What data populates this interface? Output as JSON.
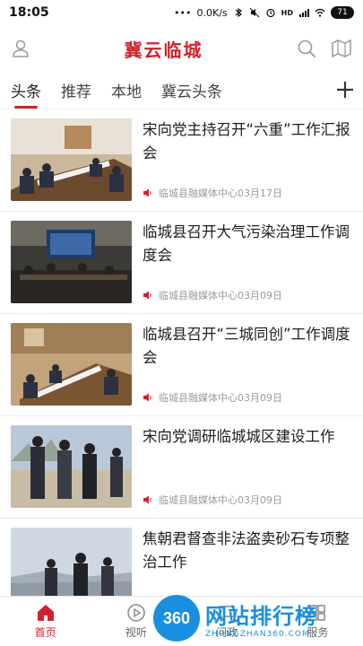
{
  "status": {
    "time": "18:05",
    "dots": "•••",
    "speed": "0.0K/s",
    "signal_hd": "HD",
    "battery": "71"
  },
  "header": {
    "logo": "冀云临城"
  },
  "tabs": [
    {
      "label": "头条"
    },
    {
      "label": "推荐"
    },
    {
      "label": "本地"
    },
    {
      "label": "冀云头条"
    }
  ],
  "news": [
    {
      "title": "宋向党主持召开“六重”工作汇报会",
      "source": "临城县融媒体中心",
      "date": "03月17日"
    },
    {
      "title": "临城县召开大气污染治理工作调度会",
      "source": "临城县融媒体中心",
      "date": "03月09日"
    },
    {
      "title": "临城县召开“三城同创”工作调度会",
      "source": "临城县融媒体中心",
      "date": "03月09日"
    },
    {
      "title": "宋向党调研临城城区建设工作",
      "source": "临城县融媒体中心",
      "date": "03月09日"
    },
    {
      "title": "焦朝君督查非法盗卖砂石专项整治工作",
      "source": "",
      "date": ""
    }
  ],
  "bottom_nav": [
    {
      "label": "首页"
    },
    {
      "label": "视听"
    },
    {
      "label": "问政"
    },
    {
      "label": "服务"
    }
  ],
  "watermark": {
    "badge": "360",
    "main": "网站排行榜",
    "sub": "ZHONGZHAN360.COM"
  },
  "colors": {
    "accent": "#d0222b",
    "watermark": "#1a8fe0"
  }
}
